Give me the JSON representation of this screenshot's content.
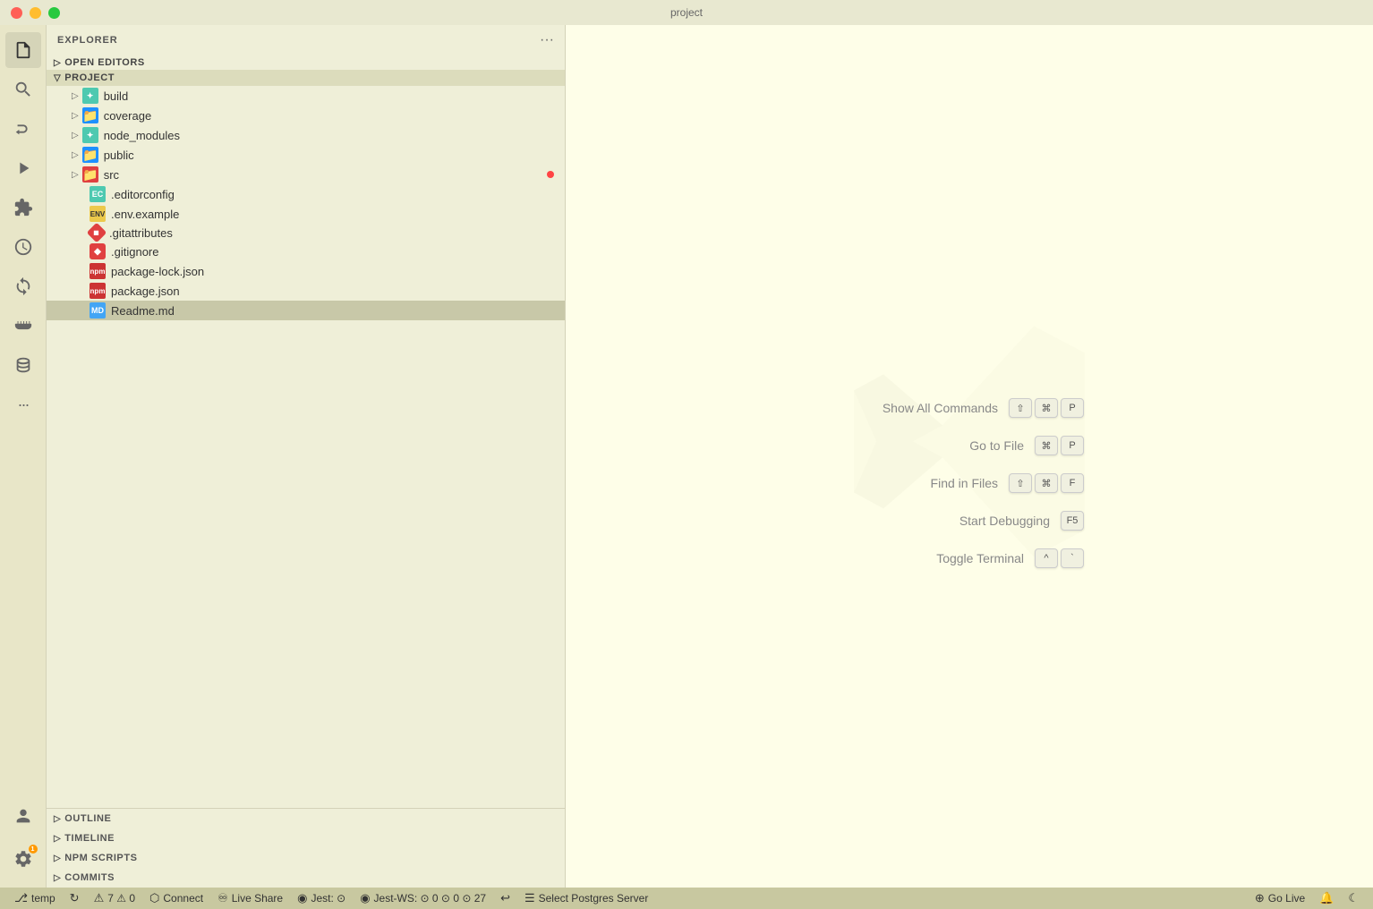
{
  "titleBar": {
    "title": "project"
  },
  "activityBar": {
    "icons": [
      {
        "name": "explorer-icon",
        "symbol": "⎘",
        "active": true
      },
      {
        "name": "search-icon",
        "symbol": "🔍",
        "active": false
      },
      {
        "name": "source-control-icon",
        "symbol": "⑂",
        "active": false
      },
      {
        "name": "run-debug-icon",
        "symbol": "▷",
        "active": false
      },
      {
        "name": "extensions-icon",
        "symbol": "⊞",
        "active": false
      },
      {
        "name": "timeline-icon",
        "symbol": "◷",
        "active": false
      },
      {
        "name": "remote-icon",
        "symbol": "↺",
        "active": false
      },
      {
        "name": "docker-icon",
        "symbol": "🐋",
        "active": false
      },
      {
        "name": "database-icon",
        "symbol": "🗄",
        "active": false
      }
    ],
    "bottomIcons": [
      {
        "name": "accounts-icon",
        "symbol": "◉"
      },
      {
        "name": "settings-icon",
        "symbol": "⚙",
        "badge": "1"
      }
    ]
  },
  "sidebar": {
    "title": "EXPLORER",
    "sections": {
      "openEditors": "OPEN EDITORS",
      "project": "PROJECT"
    },
    "fileTree": [
      {
        "type": "folder",
        "name": "build",
        "icon": "green",
        "expanded": false,
        "indent": 1
      },
      {
        "type": "folder",
        "name": "coverage",
        "icon": "blue",
        "expanded": false,
        "indent": 1
      },
      {
        "type": "folder",
        "name": "node_modules",
        "icon": "green",
        "expanded": false,
        "indent": 1
      },
      {
        "type": "folder",
        "name": "public",
        "icon": "blue",
        "expanded": false,
        "indent": 1
      },
      {
        "type": "folder",
        "name": "src",
        "icon": "blue-red",
        "expanded": false,
        "indent": 1,
        "modified": true
      },
      {
        "type": "file",
        "name": ".editorconfig",
        "icon": "editorconfig",
        "indent": 2
      },
      {
        "type": "file",
        "name": ".env.example",
        "icon": "env",
        "indent": 2
      },
      {
        "type": "file",
        "name": ".gitattributes",
        "icon": "git",
        "indent": 2
      },
      {
        "type": "file",
        "name": ".gitignore",
        "icon": "git",
        "indent": 2
      },
      {
        "type": "file",
        "name": "package-lock.json",
        "icon": "npm",
        "indent": 2
      },
      {
        "type": "file",
        "name": "package.json",
        "icon": "npm",
        "indent": 2
      },
      {
        "type": "file",
        "name": "Readme.md",
        "icon": "md",
        "indent": 2,
        "selected": true
      }
    ],
    "bottomPanels": [
      {
        "label": "OUTLINE"
      },
      {
        "label": "TIMELINE"
      },
      {
        "label": "NPM SCRIPTS"
      },
      {
        "label": "COMMITS"
      }
    ]
  },
  "editor": {
    "shortcuts": [
      {
        "label": "Show All Commands",
        "keys": [
          "⇧",
          "⌘",
          "P"
        ]
      },
      {
        "label": "Go to File",
        "keys": [
          "⌘",
          "P"
        ]
      },
      {
        "label": "Find in Files",
        "keys": [
          "⇧",
          "⌘",
          "F"
        ]
      },
      {
        "label": "Start Debugging",
        "keys": [
          "F5"
        ]
      },
      {
        "label": "Toggle Terminal",
        "keys": [
          "^",
          "`"
        ]
      }
    ]
  },
  "statusBar": {
    "left": [
      {
        "icon": "⎇",
        "text": "temp",
        "name": "branch-status"
      },
      {
        "icon": "↻",
        "text": "",
        "name": "sync-status"
      },
      {
        "icon": "⚠",
        "text": "7  ⚠ 0",
        "name": "errors-status"
      },
      {
        "icon": "⬡",
        "text": "Connect",
        "name": "connect-status"
      },
      {
        "icon": "♾",
        "text": "Live Share",
        "name": "liveshare-status"
      },
      {
        "icon": "◉",
        "text": "Jest: ⊙",
        "name": "jest-status"
      },
      {
        "icon": "◉",
        "text": "Jest-WS: ⊙ 0 ⊙ 0 ⊙ 27",
        "name": "jest-ws-status"
      },
      {
        "icon": "↩",
        "text": "",
        "name": "timeline-status"
      },
      {
        "icon": "☰",
        "text": "Select Postgres Server",
        "name": "postgres-status"
      }
    ],
    "right": [
      {
        "icon": "⊕",
        "text": "Go Live",
        "name": "golive-status"
      },
      {
        "icon": "⎋",
        "text": "",
        "name": "bell-status"
      },
      {
        "icon": "☾",
        "text": "",
        "name": "theme-status"
      }
    ]
  }
}
